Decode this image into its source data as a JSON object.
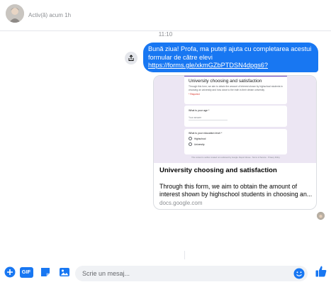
{
  "header": {
    "status": "Activ(ă) acum 1h"
  },
  "conversation": {
    "timestamp": "11:10",
    "message": {
      "text": "Bună ziua! Profa, ma puteți ajuta cu completarea acestui formular de către elevi ",
      "link": "https://forms.gle/xkmGZbPTDSN4dpgs6?"
    },
    "link_preview": {
      "form": {
        "title": "University choosing and satisfaction",
        "description": "Through this form, we aim to obtain the amount of interest shown by highschool students in choosing an university and how close to the truth is their dream university",
        "required": "* Required",
        "question_age": "What is your age *",
        "answer_placeholder": "Your answer",
        "question_education": "What is your education level *",
        "options": [
          "Highschool",
          "University"
        ],
        "footer": "This content is neither created nor endorsed by Google. Report Abuse · Terms of Service · Privacy Policy"
      },
      "title": "University choosing and satisfaction",
      "description": "Through this form, we aim to obtain the amount of interest shown by highschool students in choosing an...",
      "domain": "docs.google.com"
    }
  },
  "composer": {
    "placeholder": "Scrie un mesaj...",
    "gif_label": "GIF"
  },
  "colors": {
    "accent": "#1877f2",
    "bubble_text": "#ffffff",
    "form_accent": "#673ab7"
  }
}
